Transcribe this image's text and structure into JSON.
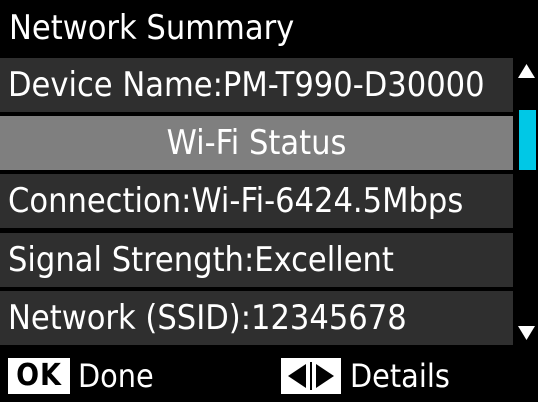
{
  "header": {
    "title": "Network Summary"
  },
  "list": {
    "rows": [
      {
        "text": "Device Name:PM-T990-D30000"
      },
      {
        "text": "Wi-Fi Status"
      },
      {
        "text": "Connection:Wi-Fi-6424.5Mbps"
      },
      {
        "text": "Signal Strength:Excellent"
      },
      {
        "text": "Network (SSID):12345678"
      }
    ],
    "scroll_position": 0.2
  },
  "footer": {
    "ok_badge": "OK",
    "ok_label": "Done",
    "lr_icon": "left-right-arrows-icon",
    "lr_label": "Details"
  },
  "colors": {
    "background": "#000000",
    "row_background": "#2f2f2f",
    "highlight_row_background": "#7f7f7f",
    "text": "#ffffff",
    "scroll_thumb": "#00c8e6"
  }
}
